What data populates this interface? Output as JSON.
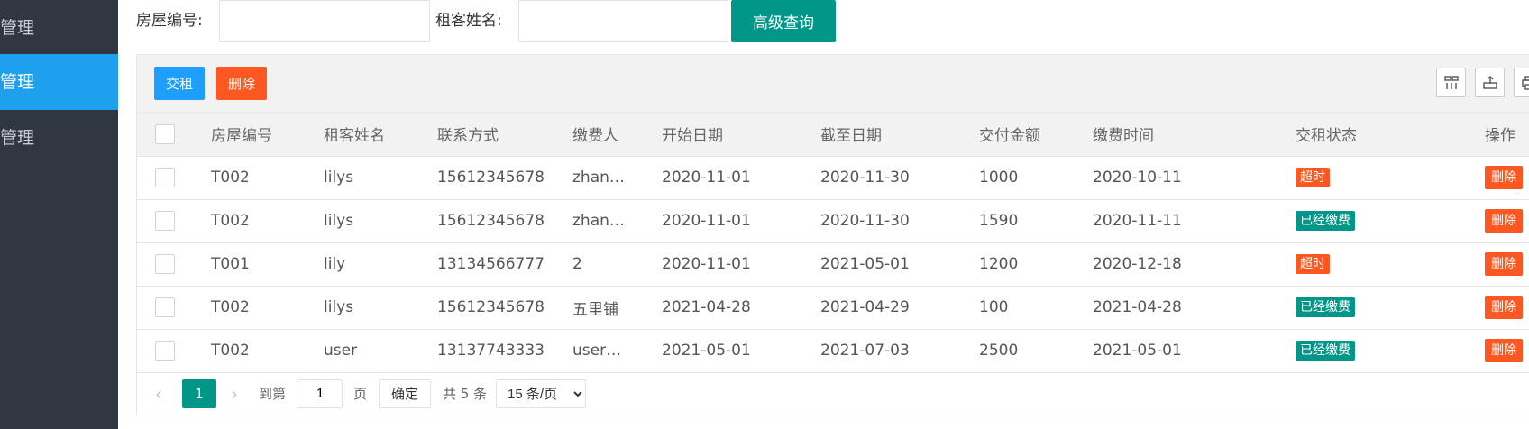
{
  "sidebar": {
    "items": [
      {
        "label": "息管理"
      },
      {
        "label": "息管理"
      },
      {
        "label": "息管理"
      }
    ]
  },
  "search": {
    "house_label": "房屋编号:",
    "tenant_label": "租客姓名:",
    "house_value": "",
    "tenant_value": "",
    "submit_label": "高级查询"
  },
  "toolbar": {
    "pay_label": "交租",
    "delete_label": "删除",
    "icons": [
      "columns-icon",
      "export-icon",
      "print-icon"
    ]
  },
  "table": {
    "headers": [
      "房屋编号",
      "租客姓名",
      "联系方式",
      "缴费人",
      "开始日期",
      "截至日期",
      "交付金额",
      "缴费时间",
      "交租状态",
      "操作"
    ],
    "rows": [
      {
        "house": "T002",
        "tenant": "lilys",
        "phone": "15612345678",
        "payer": "zhan…",
        "start": "2020-11-01",
        "end": "2020-11-30",
        "amount": "1000",
        "paid_at": "2020-10-11",
        "status": "超时",
        "status_type": "late",
        "action": "删除"
      },
      {
        "house": "T002",
        "tenant": "lilys",
        "phone": "15612345678",
        "payer": "zhan…",
        "start": "2020-11-01",
        "end": "2020-11-30",
        "amount": "1590",
        "paid_at": "2020-11-11",
        "status": "已经缴费",
        "status_type": "paid",
        "action": "删除"
      },
      {
        "house": "T001",
        "tenant": "lily",
        "phone": "13134566777",
        "payer": "2",
        "start": "2020-11-01",
        "end": "2021-05-01",
        "amount": "1200",
        "paid_at": "2020-12-18",
        "status": "超时",
        "status_type": "late",
        "action": "删除"
      },
      {
        "house": "T002",
        "tenant": "lilys",
        "phone": "15612345678",
        "payer": "五里铺",
        "start": "2021-04-28",
        "end": "2021-04-29",
        "amount": "100",
        "paid_at": "2021-04-28",
        "status": "已经缴费",
        "status_type": "paid",
        "action": "删除"
      },
      {
        "house": "T002",
        "tenant": "user",
        "phone": "13137743333",
        "payer": "user'…",
        "start": "2021-05-01",
        "end": "2021-07-03",
        "amount": "2500",
        "paid_at": "2021-05-01",
        "status": "已经缴费",
        "status_type": "paid",
        "action": "删除"
      }
    ]
  },
  "pager": {
    "current": "1",
    "goto_label": "到第",
    "page_input": "1",
    "page_unit": "页",
    "confirm_label": "确定",
    "total_label": "共 5 条",
    "page_size": "15 条/页"
  },
  "colors": {
    "sidebar_bg": "#2f3741",
    "sidebar_active": "#1fa0ef",
    "primary": "#009688",
    "blue": "#1e9fff",
    "danger": "#ff5722"
  }
}
